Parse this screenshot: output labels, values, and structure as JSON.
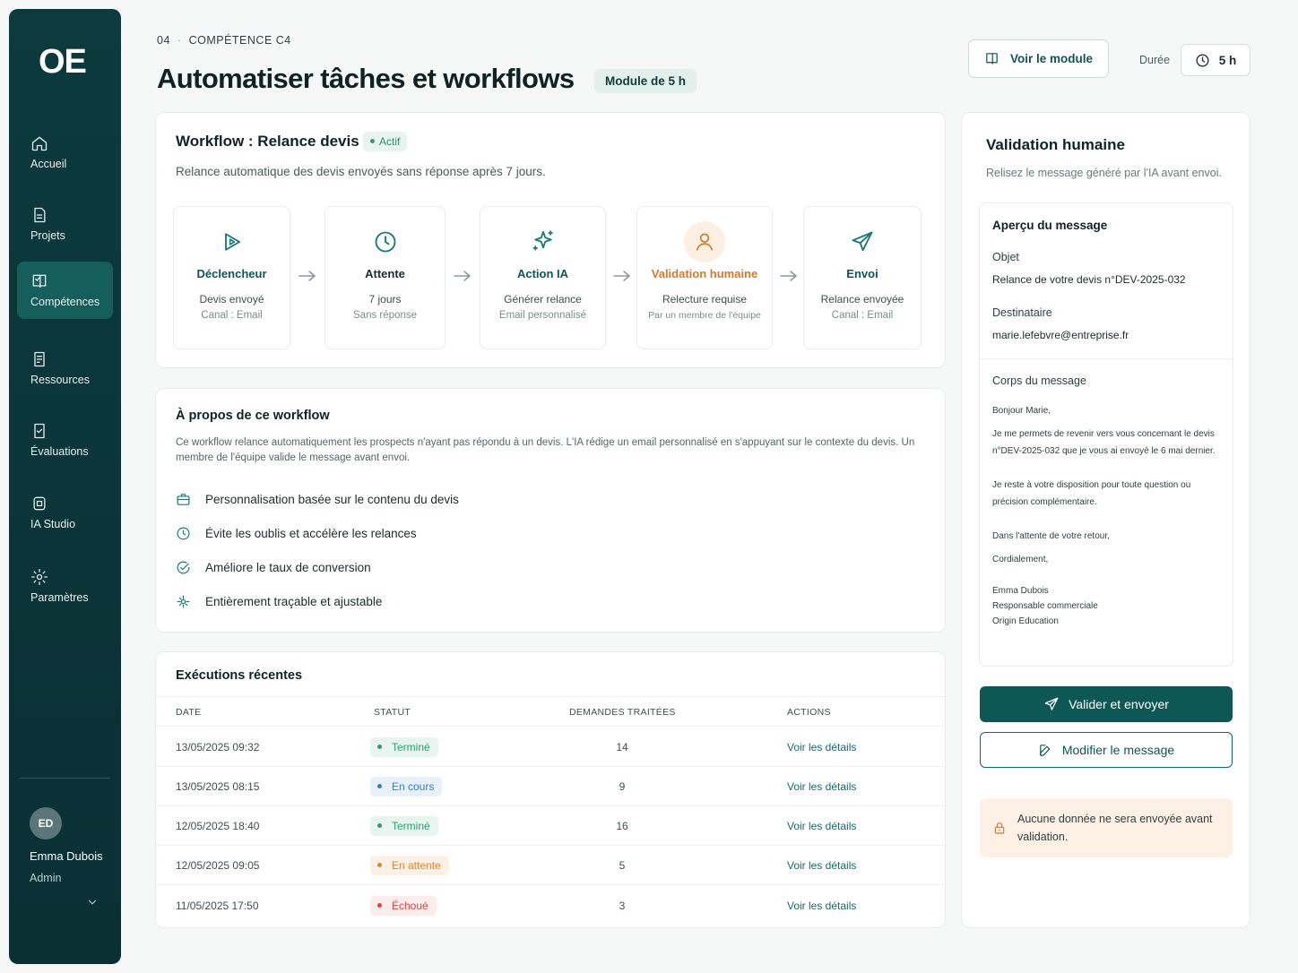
{
  "sidebar": {
    "logo": "OE",
    "items": [
      {
        "label": "Accueil",
        "icon": "home-icon"
      },
      {
        "label": "Projets",
        "icon": "file-icon"
      },
      {
        "label": "Compétences",
        "icon": "book-icon",
        "active": true
      },
      {
        "label": "Ressources",
        "icon": "resource-icon"
      },
      {
        "label": "Évaluations",
        "icon": "evaluation-icon"
      },
      {
        "label": "IA Studio",
        "icon": "ia-studio-icon"
      },
      {
        "label": "Paramètres",
        "icon": "gear-icon"
      }
    ],
    "user": {
      "initials": "ED",
      "name": "Emma Dubois",
      "role": "Admin"
    }
  },
  "header": {
    "breadcrumb_num": "04",
    "breadcrumb_label": "COMPÉTENCE C4",
    "title": "Automatiser tâches et workflows",
    "module_pill": "Module de 5 h",
    "voir_module": "Voir le module",
    "duree_label": "Durée",
    "duree_value": "5 h"
  },
  "workflow": {
    "title": "Workflow : Relance devis",
    "status": "Actif",
    "description": "Relance automatique des devis envoyés sans réponse après 7 jours.",
    "steps": [
      {
        "title": "Déclencheur",
        "line1": "Devis envoyé",
        "line2": "Canal : Email",
        "icon": "play-icon"
      },
      {
        "title": "Attente",
        "line1": "7 jours",
        "line2": "Sans réponse",
        "icon": "clock-icon"
      },
      {
        "title": "Action IA",
        "line1": "Générer relance",
        "line2": "Email personnalisé",
        "icon": "sparkle-icon"
      },
      {
        "title": "Validation humaine",
        "line1": "Relecture requise",
        "line2": "Par un membre de l'équipe",
        "icon": "user-icon"
      },
      {
        "title": "Envoi",
        "line1": "Relance envoyée",
        "line2": "Canal : Email",
        "icon": "send-icon"
      }
    ]
  },
  "about": {
    "title": "À propos de ce workflow",
    "description": "Ce workflow relance automatiquement les prospects n'ayant pas répondu à un devis. L'IA rédige un email personnalisé en s'appuyant sur le contexte du devis. Un membre de l'équipe valide le message avant envoi.",
    "features": [
      {
        "text": "Personnalisation basée sur le contenu du devis",
        "icon": "briefcase-icon"
      },
      {
        "text": "Évite les oublis et accélère les relances",
        "icon": "clock-icon"
      },
      {
        "text": "Améliore le taux de conversion",
        "icon": "check-circle-icon"
      },
      {
        "text": "Entièrement traçable et ajustable",
        "icon": "adjust-icon"
      }
    ]
  },
  "executions": {
    "title": "Exécutions récentes",
    "columns": [
      "DATE",
      "STATUT",
      "DEMANDES TRAITÉES",
      "ACTIONS"
    ],
    "rows": [
      {
        "date": "13/05/2025 09:32",
        "status": "Terminé",
        "count": "14",
        "action": "Voir les détails",
        "kind": "done"
      },
      {
        "date": "13/05/2025 08:15",
        "status": "En cours",
        "count": "9",
        "action": "Voir les détails",
        "kind": "progress"
      },
      {
        "date": "12/05/2025 18:40",
        "status": "Terminé",
        "count": "16",
        "action": "Voir les détails",
        "kind": "done"
      },
      {
        "date": "12/05/2025 09:05",
        "status": "En attente",
        "count": "5",
        "action": "Voir les détails",
        "kind": "waiting"
      },
      {
        "date": "11/05/2025 17:50",
        "status": "Échoué",
        "count": "3",
        "action": "Voir les détails",
        "kind": "failed"
      }
    ]
  },
  "validation": {
    "title": "Validation humaine",
    "subtitle": "Relisez le message généré par l'IA avant envoi.",
    "preview_title": "Aperçu du message",
    "subject_label": "Objet",
    "subject": "Relance de votre devis n°DEV-2025-032",
    "recipient_label": "Destinataire",
    "recipient": "marie.lefebvre@entreprise.fr",
    "body_label": "Corps du message",
    "body_greeting": "Bonjour Marie,",
    "body_p1": "Je me permets de revenir vers vous concernant le devis n°DEV-2025-032 que je vous ai envoyé le 6 mai dernier.",
    "body_p2": "Je reste à votre disposition pour toute question ou précision complémentaire.",
    "body_p3": "Dans l'attente de votre retour,",
    "body_p4": "Cordialement,",
    "sig_name": "Emma Dubois",
    "sig_role": "Responsable commerciale",
    "sig_company": "Origin Education",
    "validate_btn": "Valider et envoyer",
    "modify_btn": "Modifier le message",
    "notice": "Aucune donnée ne sera envoyée avant validation."
  },
  "colors": {
    "sidebar_bg": "#0c3a3d",
    "accent": "#0d5855",
    "human_accent": "#d27a2c",
    "status_done": "#2f9d72",
    "status_progress": "#2a7fc9",
    "status_waiting": "#e0842f",
    "status_failed": "#d64545"
  }
}
